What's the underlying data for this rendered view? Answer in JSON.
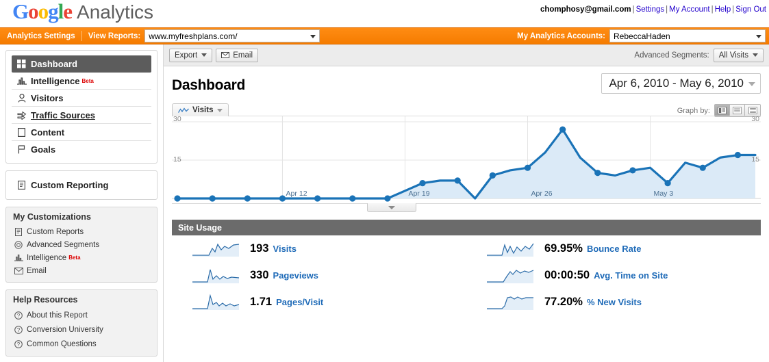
{
  "header": {
    "logo_google": "Google",
    "logo_suffix": "Analytics",
    "account_email": "chomphosy@gmail.com",
    "links": [
      "Settings",
      "My Account",
      "Help",
      "Sign Out"
    ]
  },
  "orange_bar": {
    "settings_link": "Analytics Settings",
    "view_reports_label": "View Reports:",
    "view_reports_value": "www.myfreshplans.com/",
    "accounts_label": "My Analytics Accounts:",
    "accounts_value": "RebeccaHaden"
  },
  "sidebar": {
    "nav": [
      {
        "label": "Dashboard",
        "icon": "grid-icon",
        "active": true
      },
      {
        "label": "Intelligence",
        "icon": "bars-icon",
        "badge": "Beta"
      },
      {
        "label": "Visitors",
        "icon": "person-icon"
      },
      {
        "label": "Traffic Sources",
        "icon": "arrows-icon",
        "current": true
      },
      {
        "label": "Content",
        "icon": "page-icon"
      },
      {
        "label": "Goals",
        "icon": "flag-icon"
      }
    ],
    "custom_reporting": {
      "label": "Custom Reporting",
      "icon": "report-icon"
    },
    "customizations": {
      "title": "My Customizations",
      "items": [
        {
          "label": "Custom Reports",
          "icon": "report-icon"
        },
        {
          "label": "Advanced Segments",
          "icon": "target-icon"
        },
        {
          "label": "Intelligence",
          "icon": "bars-icon",
          "badge": "Beta"
        },
        {
          "label": "Email",
          "icon": "envelope-icon"
        }
      ]
    },
    "help": {
      "title": "Help Resources",
      "items": [
        {
          "label": "About this Report",
          "icon": "question-icon"
        },
        {
          "label": "Conversion University",
          "icon": "question-icon"
        },
        {
          "label": "Common Questions",
          "icon": "question-icon"
        }
      ]
    }
  },
  "toolbar": {
    "export_label": "Export",
    "email_label": "Email",
    "advanced_segments_label": "Advanced Segments:",
    "advanced_segments_value": "All Visits"
  },
  "page": {
    "title": "Dashboard",
    "date_range": "Apr 6, 2010 - May 6, 2010"
  },
  "chart_panel": {
    "metric_tab": "Visits",
    "graph_by_label": "Graph by:",
    "graph_by_options": [
      "day",
      "week",
      "month"
    ],
    "graph_by_selected": "day"
  },
  "chart_data": {
    "type": "line",
    "title": "Visits",
    "xlabel": "",
    "ylabel": "Visits",
    "ylim": [
      0,
      30
    ],
    "yticks": [
      15,
      30
    ],
    "ytick_labels_left": [
      "15",
      "30"
    ],
    "ytick_labels_right": [
      "15",
      "30"
    ],
    "grid": true,
    "legend": "none",
    "x_tick_labels": [
      "Apr 12",
      "Apr 19",
      "Apr 26",
      "May 3"
    ],
    "x_tick_indices": [
      6,
      13,
      20,
      27
    ],
    "accent_color": "#1a73b7",
    "fill_color": "#dbeaf7",
    "x": [
      "Apr 6",
      "Apr 7",
      "Apr 8",
      "Apr 9",
      "Apr 10",
      "Apr 11",
      "Apr 12",
      "Apr 13",
      "Apr 14",
      "Apr 15",
      "Apr 16",
      "Apr 17",
      "Apr 18",
      "Apr 19",
      "Apr 20",
      "Apr 21",
      "Apr 22",
      "Apr 23",
      "Apr 24",
      "Apr 25",
      "Apr 26",
      "Apr 27",
      "Apr 28",
      "Apr 29",
      "Apr 30",
      "May 1",
      "May 2",
      "May 3",
      "May 4",
      "May 5",
      "May 6"
    ],
    "values": [
      0,
      0,
      0,
      0,
      0,
      0,
      0,
      0,
      0,
      0,
      0,
      0,
      0,
      3,
      6,
      7,
      7,
      0,
      9,
      11,
      12,
      18,
      27,
      16,
      10,
      9,
      11,
      12,
      6,
      14,
      12,
      16,
      17,
      17
    ],
    "series": [
      {
        "name": "Visits",
        "values": [
          0,
          0,
          0,
          0,
          0,
          0,
          0,
          0,
          0,
          0,
          0,
          0,
          0,
          3,
          6,
          7,
          7,
          0,
          9,
          11,
          12,
          18,
          27,
          16,
          10,
          9,
          11,
          12,
          6,
          14,
          12,
          16,
          17,
          17
        ]
      }
    ]
  },
  "site_usage": {
    "title": "Site Usage",
    "metrics": [
      {
        "value": "193",
        "label": "Visits"
      },
      {
        "value": "69.95%",
        "label": "Bounce Rate"
      },
      {
        "value": "330",
        "label": "Pageviews"
      },
      {
        "value": "00:00:50",
        "label": "Avg. Time on Site"
      },
      {
        "value": "1.71",
        "label": "Pages/Visit"
      },
      {
        "value": "77.20%",
        "label": "% New Visits"
      }
    ]
  }
}
